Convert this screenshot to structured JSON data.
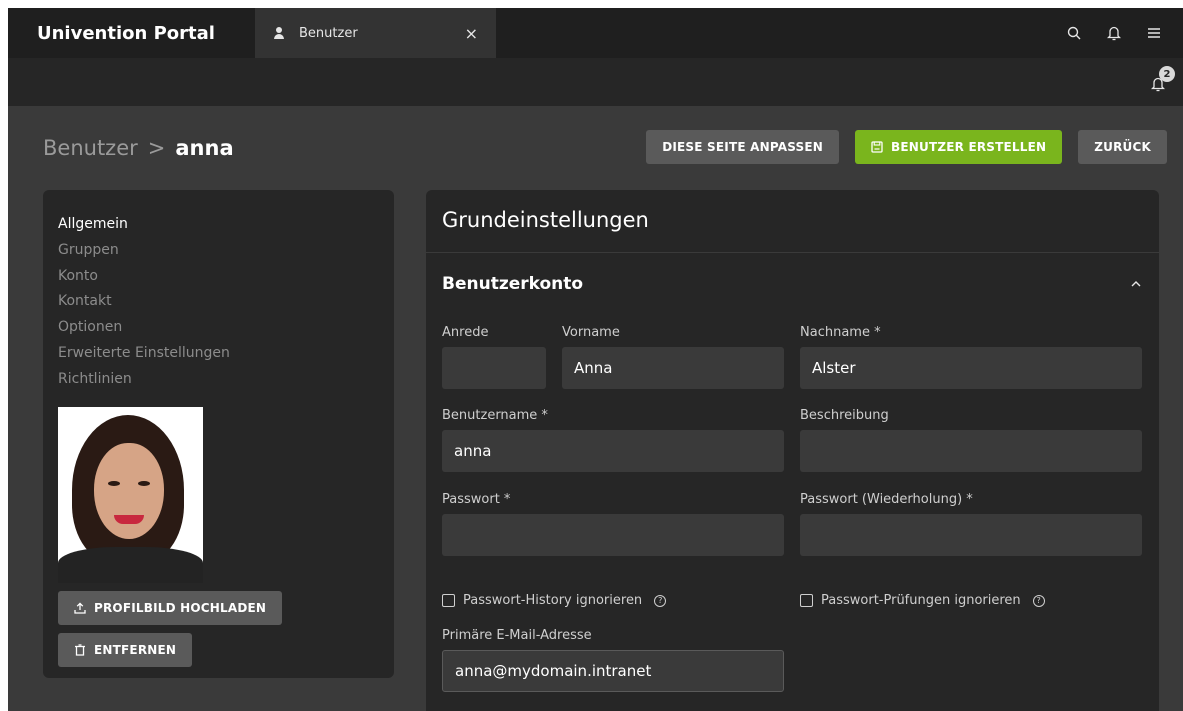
{
  "topbar": {
    "brand": "Univention Portal",
    "tab_label": "Benutzer",
    "close_symbol": "×"
  },
  "notifications": {
    "count": "2"
  },
  "breadcrumb": {
    "parent": "Benutzer",
    "separator": ">",
    "current": "anna"
  },
  "actions": {
    "customize": "DIESE SEITE ANPASSEN",
    "create": "BENUTZER ERSTELLEN",
    "back": "ZURÜCK"
  },
  "nav": {
    "items": [
      "Allgemein",
      "Gruppen",
      "Konto",
      "Kontakt",
      "Optionen",
      "Erweiterte Einstellungen",
      "Richtlinien"
    ]
  },
  "photo": {
    "upload": "PROFILBILD HOCHLADEN",
    "remove": "ENTFERNEN"
  },
  "form": {
    "title": "Grundeinstellungen",
    "section": "Benutzerkonto",
    "anrede_label": "Anrede",
    "anrede_value": "",
    "vorname_label": "Vorname",
    "vorname_value": "Anna",
    "nachname_label": "Nachname *",
    "nachname_value": "Alster",
    "username_label": "Benutzername *",
    "username_value": "anna",
    "beschreibung_label": "Beschreibung",
    "beschreibung_value": "",
    "passwort_label": "Passwort *",
    "passwort_value": "",
    "passwort2_label": "Passwort (Wiederholung) *",
    "passwort2_value": "",
    "history_label": "Passwort-History ignorieren",
    "checks_label": "Passwort-Prüfungen ignorieren",
    "email_label": "Primäre E-Mail-Adresse",
    "email_value": "anna@mydomain.intranet",
    "help_symbol": "?"
  },
  "colors": {
    "accent_green": "#7ab51d",
    "topbar": "#1f1f1f",
    "panel": "#262626",
    "background": "#3a3a3a"
  }
}
